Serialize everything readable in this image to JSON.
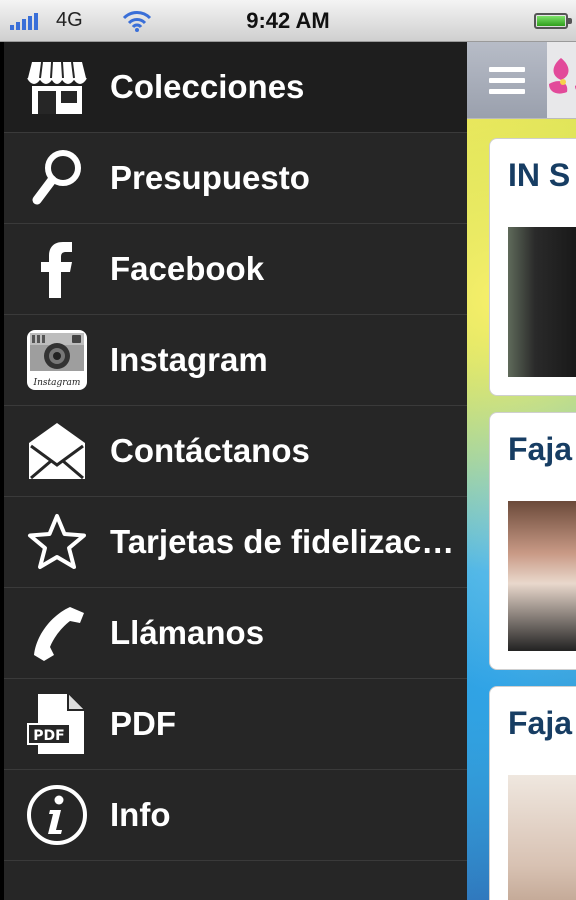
{
  "status": {
    "carrier": "4G",
    "time": "9:42 AM"
  },
  "menu": {
    "items": [
      {
        "label": "Colecciones",
        "icon": "store-icon"
      },
      {
        "label": "Presupuesto",
        "icon": "search-icon"
      },
      {
        "label": "Facebook",
        "icon": "facebook-icon"
      },
      {
        "label": "Instagram",
        "icon": "instagram-icon"
      },
      {
        "label": "Contáctanos",
        "icon": "envelope-icon"
      },
      {
        "label": "Tarjetas de fidelización",
        "icon": "star-icon"
      },
      {
        "label": "Llámanos",
        "icon": "phone-icon"
      },
      {
        "label": "PDF",
        "icon": "pdf-icon"
      },
      {
        "label": "Info",
        "icon": "info-icon"
      }
    ],
    "instagram_icon_text": "Instagram",
    "pdf_icon_text": "PDF"
  },
  "content": {
    "cards": [
      {
        "title": "IN S"
      },
      {
        "title": "Faja"
      },
      {
        "title": "Faja"
      }
    ]
  },
  "colors": {
    "menu_bg": "#262626",
    "title_blue": "#173d63",
    "hamburger_bg": "#9aa0ad"
  }
}
